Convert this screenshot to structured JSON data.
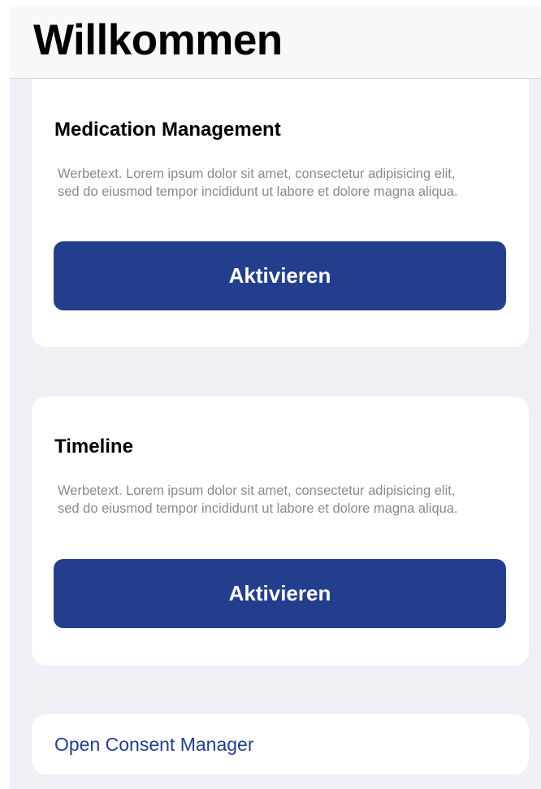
{
  "header": {
    "title": "Willkommen"
  },
  "cards": [
    {
      "title": "Medication Management",
      "description": "Werbetext. Lorem ipsum dolor sit amet, consectetur adipisicing elit, sed do eiusmod tempor incididunt ut labore et dolore magna aliqua.",
      "button_label": "Aktivieren"
    },
    {
      "title": "Timeline",
      "description": "Werbetext. Lorem ipsum dolor sit amet, consectetur adipisicing elit, sed do eiusmod tempor incididunt ut labore et dolore magna aliqua.",
      "button_label": "Aktivieren"
    }
  ],
  "consent": {
    "link_label": "Open Consent Manager"
  },
  "colors": {
    "accent": "#233e8c",
    "background": "#f0eff5",
    "card": "#ffffff",
    "secondary_text": "#8a8a8e"
  }
}
